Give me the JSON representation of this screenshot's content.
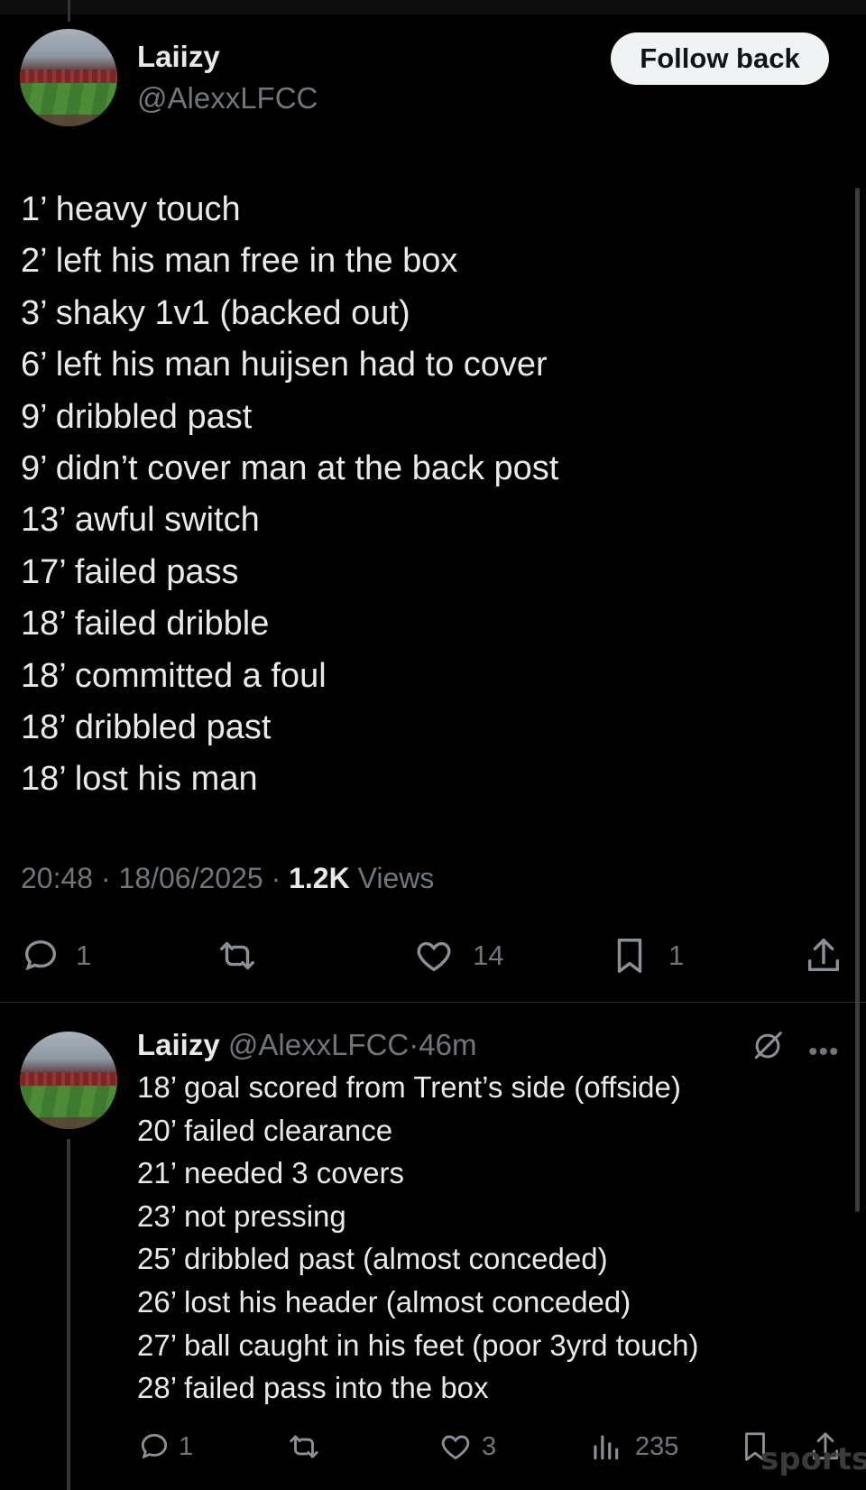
{
  "tweet": {
    "author_name": "Laiizy",
    "author_handle": "@AlexxLFCC",
    "follow_label": "Follow back",
    "lines": [
      "1’ heavy touch",
      "2’ left his man free in the box",
      "3’ shaky 1v1 (backed out)",
      "6’ left his man huijsen had to cover",
      "9’ dribbled past",
      "9’ didn’t cover man at the back post",
      "13’ awful switch",
      "17’ failed pass",
      "18’ failed dribble",
      "18’ committed a foul",
      "18’ dribbled past",
      "18’ lost his man"
    ],
    "time": "20:48",
    "date": "18/06/2025",
    "views_count": "1.2K",
    "views_label": "Views",
    "separator": "·",
    "replies": "1",
    "likes": "14",
    "bookmarks": "1"
  },
  "reply": {
    "author_name": "Laiizy",
    "author_handle": "@AlexxLFCC",
    "age": "46m",
    "separator": "·",
    "lines": [
      "18’ goal scored from Trent’s side (offside)",
      "20’ failed clearance",
      "21’ needed 3 covers",
      "23’ not pressing",
      "25’ dribbled past (almost conceded)",
      "26’ lost his header (almost conceded)",
      "27’ ball caught in his feet (poor 3yrd touch)",
      "28’ failed pass into the box"
    ],
    "replies": "1",
    "likes": "3",
    "views": "235",
    "more_label": "•••"
  },
  "watermark": "sports",
  "icons": [
    "reply-icon",
    "retweet-icon",
    "like-icon",
    "bookmark-icon",
    "share-icon",
    "views-icon",
    "grok-icon",
    "more-icon"
  ],
  "colors": {
    "background": "#000000",
    "text": "#e7e9ea",
    "muted": "#71767b",
    "follow_button_bg": "#eff3f4"
  }
}
